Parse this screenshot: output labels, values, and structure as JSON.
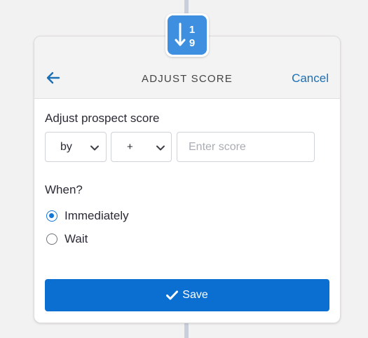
{
  "header": {
    "title": "ADJUST SCORE",
    "cancel_label": "Cancel"
  },
  "step_icon": {
    "name": "sort-numeric-icon",
    "digit_top": "1",
    "digit_bottom": "9",
    "color": "#3e8fe0"
  },
  "form": {
    "adjust_label": "Adjust prospect score",
    "mode_select": {
      "selected": "by"
    },
    "operator_select": {
      "selected": "+"
    },
    "score_input": {
      "value": "",
      "placeholder": "Enter score"
    },
    "when_label": "When?",
    "when_options": [
      {
        "label": "Immediately",
        "checked": true
      },
      {
        "label": "Wait",
        "checked": false
      }
    ]
  },
  "actions": {
    "save_label": "Save",
    "save_color": "#0b6fd2"
  }
}
